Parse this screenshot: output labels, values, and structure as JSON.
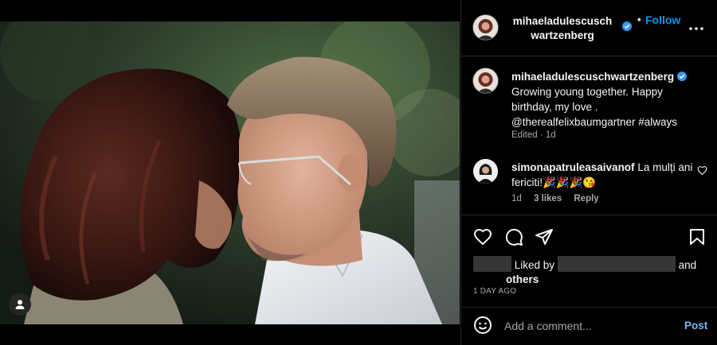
{
  "header": {
    "username": "mihaeladulescuschwartzenberg",
    "separator": "•",
    "follow_label": "Follow",
    "more_icon": "more-horizontal-icon"
  },
  "caption": {
    "username": "mihaeladulescuschwartzenberg",
    "text": "Growing young together. Happy birthday, my love . @therealfelixbaumgartner #always",
    "meta": "Edited · 1d"
  },
  "comment": {
    "username": "simonapatruleasaivanof",
    "text": "La mulți ani fericiti!🎉🎉🎉😘",
    "age": "1d",
    "likes": "3 likes",
    "reply_label": "Reply"
  },
  "actions": {
    "liked_by_prefix": "Liked by",
    "and_label": "and",
    "others_label": "others",
    "time_ago": "1 DAY AGO"
  },
  "add_comment": {
    "placeholder": "Add a comment...",
    "post_label": "Post"
  },
  "colors": {
    "background": "#000000",
    "accent": "#0095f6",
    "verified": "#3897f0",
    "muted_text": "#a8a8a8",
    "divider": "#262626"
  }
}
